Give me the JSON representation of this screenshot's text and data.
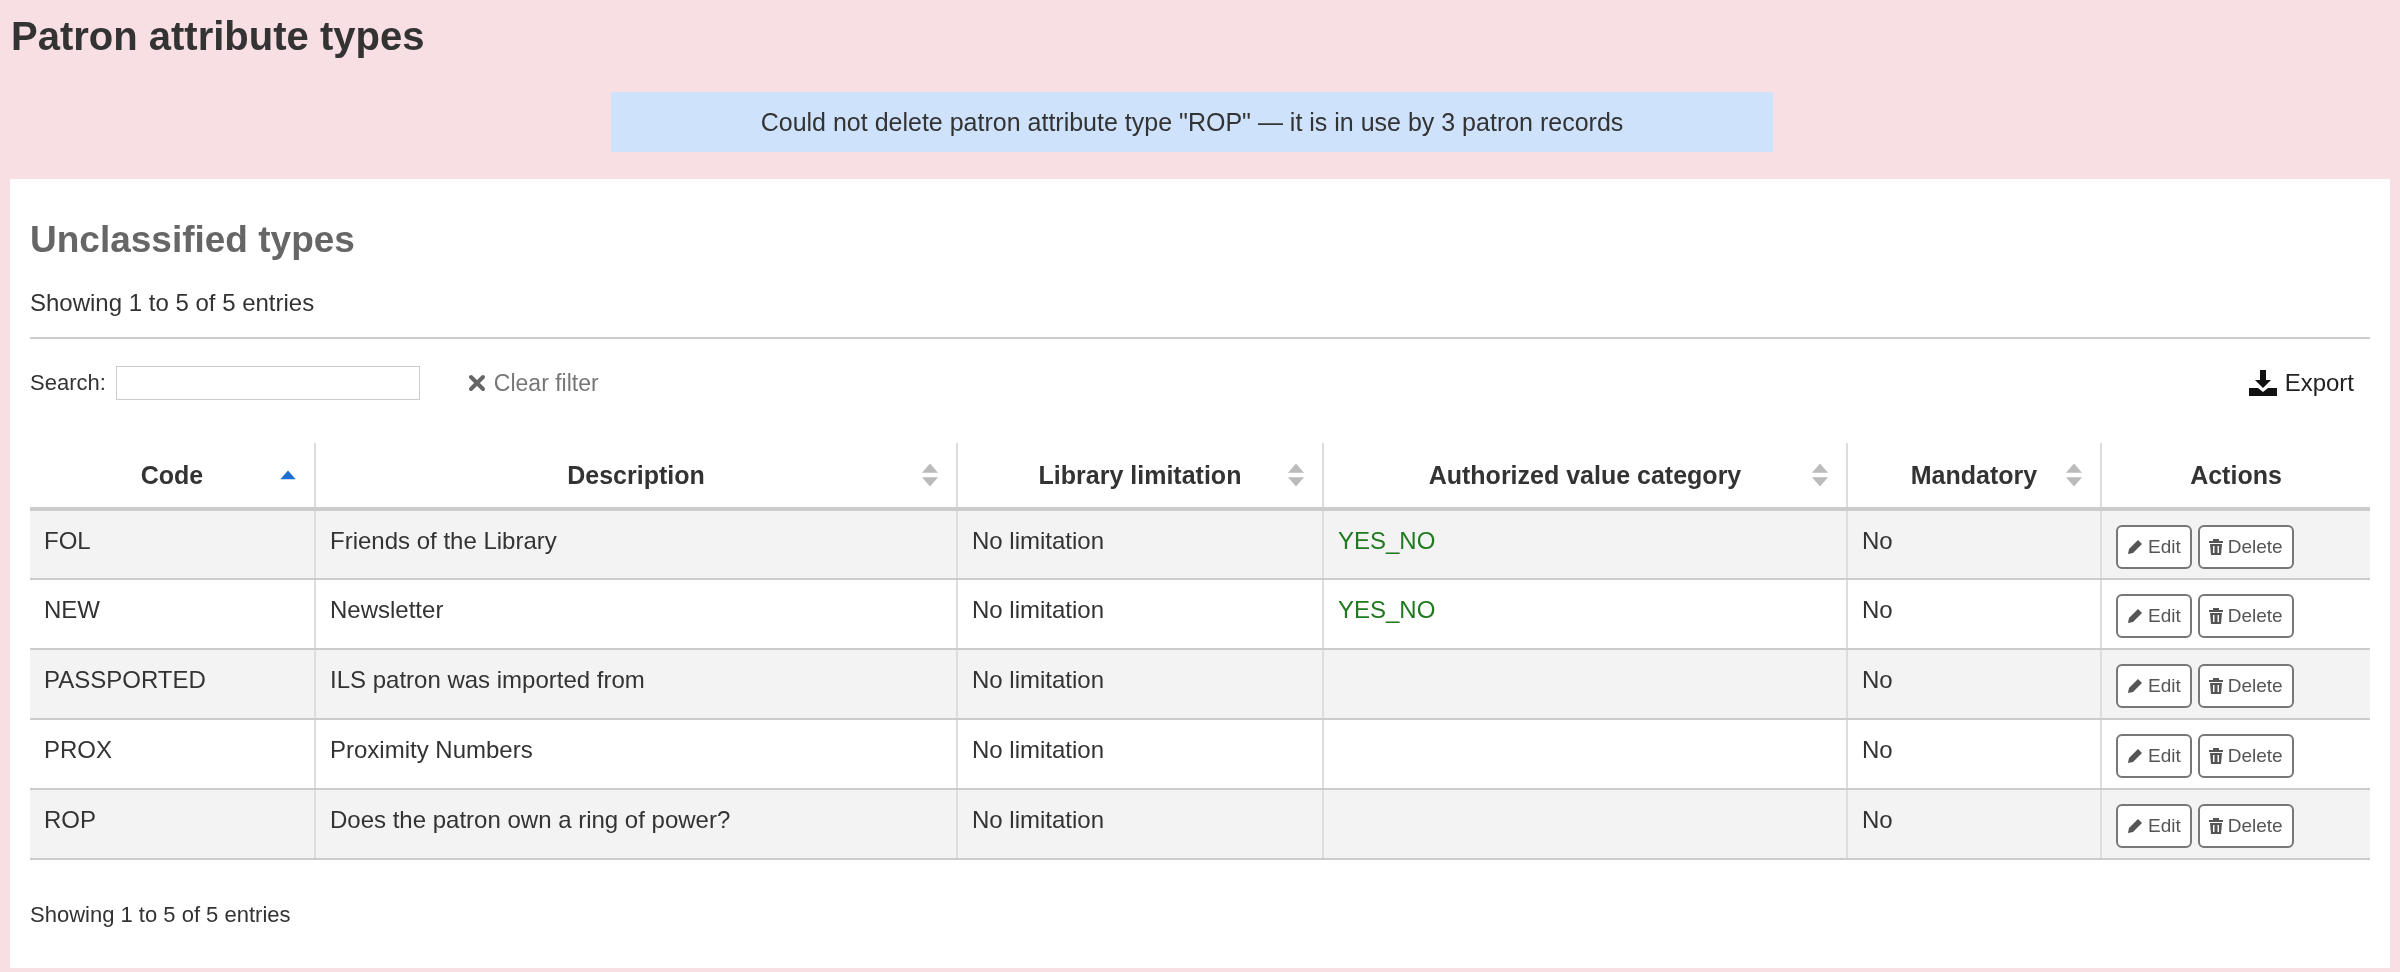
{
  "page_title": "Patron attribute types",
  "alert": "Could not delete patron attribute type \"ROP\" — it is in use by 3 patron records",
  "section": {
    "title": "Unclassified types",
    "info_top": "Showing 1 to 5 of 5 entries",
    "search": {
      "label": "Search:"
    },
    "clear_filter": "Clear filter",
    "export": "Export",
    "columns": [
      {
        "label": "Code",
        "sortable": true,
        "sorted": true
      },
      {
        "label": "Description",
        "sortable": true,
        "sorted": false
      },
      {
        "label": "Library limitation",
        "sortable": true,
        "sorted": false
      },
      {
        "label": "Authorized value category",
        "sortable": true,
        "sorted": false
      },
      {
        "label": "Mandatory",
        "sortable": true,
        "sorted": false
      },
      {
        "label": "Actions",
        "sortable": false,
        "sorted": false
      }
    ],
    "rows": [
      {
        "code": "FOL",
        "description": "Friends of the Library",
        "library_limitation": "No limitation",
        "authorized_value_category": "YES_NO",
        "mandatory": "No",
        "actions": [
          "Edit",
          "Delete"
        ]
      },
      {
        "code": "NEW",
        "description": "Newsletter",
        "library_limitation": "No limitation",
        "authorized_value_category": "YES_NO",
        "mandatory": "No",
        "actions": [
          "Edit",
          "Delete"
        ]
      },
      {
        "code": "PASSPORTED",
        "description": "ILS patron was imported from",
        "library_limitation": "No limitation",
        "mandatory": "No",
        "actions": [
          "Edit",
          "Delete"
        ]
      },
      {
        "code": "PROX",
        "description": "Proximity Numbers",
        "library_limitation": "No limitation",
        "mandatory": "No",
        "actions": [
          "Edit",
          "Delete"
        ]
      },
      {
        "code": "ROP",
        "description": "Does the patron own a ring of power?",
        "library_limitation": "No limitation",
        "mandatory": "No",
        "actions": [
          "Edit",
          "Delete"
        ]
      }
    ],
    "info_bottom": "Showing 1 to 5 of 5 entries"
  }
}
